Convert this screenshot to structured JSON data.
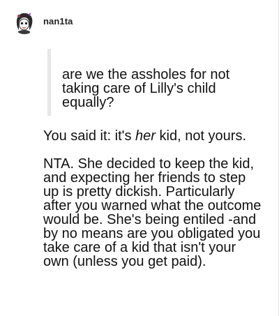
{
  "post": {
    "username": "nan1ta",
    "quote": "are we the assholes for not taking care of Lilly's child equally?",
    "reply": {
      "line1_before": "You said it: it's ",
      "line1_emph": "her",
      "line1_after": " kid, not yours.",
      "body": "NTA. She decided to keep the kid, and expecting her friends to step up is pretty dickish. Particularly after you warned what the outcome would be. She's being entiled -and by no means are you obligated you take care of a kid that isn't your own (unless you get paid)."
    }
  },
  "icons": {
    "avatar": "user-avatar-icon"
  }
}
